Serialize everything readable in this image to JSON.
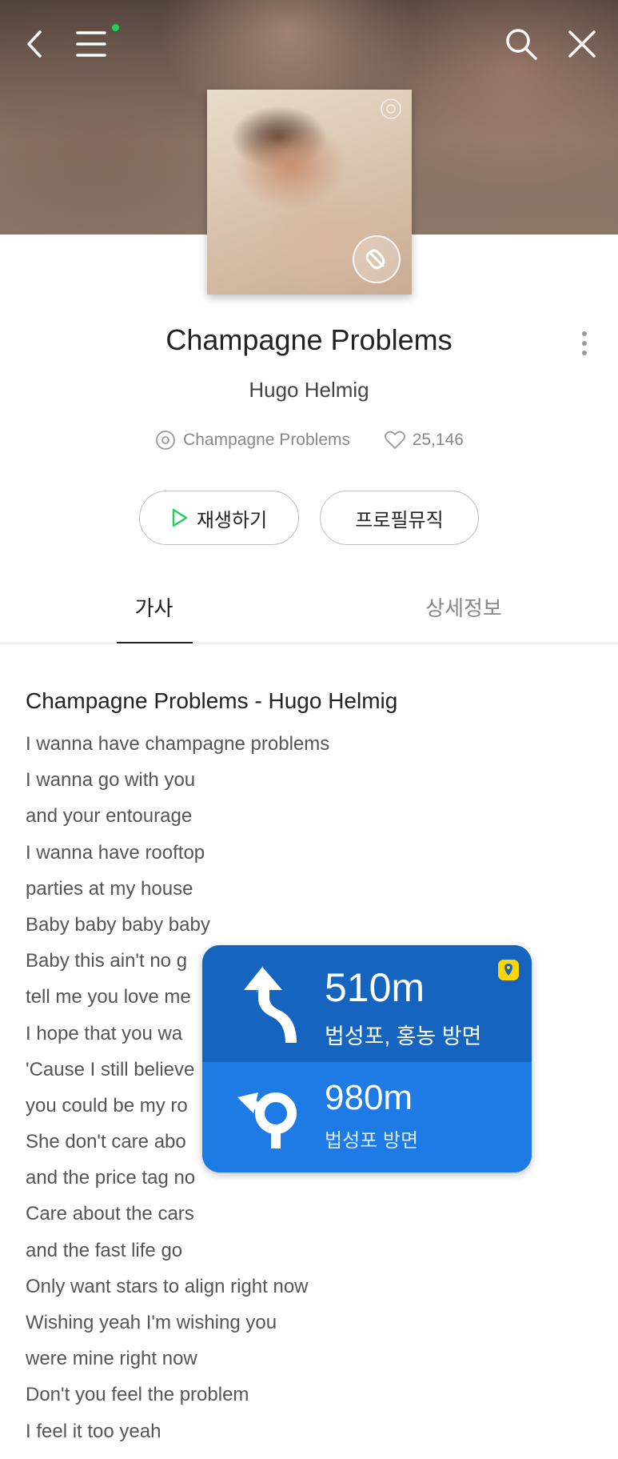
{
  "header": {
    "back_icon": "back-chevron-icon",
    "menu_icon": "hamburger-menu-icon",
    "search_icon": "search-icon",
    "close_icon": "close-icon",
    "menu_badge_color": "#1ecf5a"
  },
  "song": {
    "title": "Champagne Problems",
    "artist": "Hugo Helmig",
    "album": "Champagne Problems",
    "likes": "25,146"
  },
  "buttons": {
    "play": "재생하기",
    "profile_music": "프로필뮤직",
    "play_icon_color": "#1ecf5a"
  },
  "tabs": {
    "lyrics": "가사",
    "details": "상세정보"
  },
  "lyrics": {
    "heading": "Champagne Problems - Hugo Helmig",
    "lines": [
      "I wanna have champagne problems",
      "I wanna go with you",
      "and your entourage",
      "I wanna have rooftop",
      "parties at my house",
      "Baby baby baby baby",
      "Baby this ain't no g",
      "tell me you love me",
      "I hope that you wa",
      "'Cause I still believe",
      "you could be my ro",
      "She don't care abo",
      "and the price tag no",
      "Care about the cars",
      "and the fast life go",
      "Only want stars to align right now",
      "Wishing yeah I'm wishing you",
      "were mine right now",
      "Don't you feel the problem",
      "I feel it too yeah"
    ]
  },
  "navigation": {
    "primary": {
      "distance": "510m",
      "direction": "법성포, 홍농 방면",
      "icon": "turn-left-then-up-arrow-icon"
    },
    "secondary": {
      "distance": "980m",
      "direction": "법성포 방면",
      "icon": "u-turn-left-arrow-icon"
    },
    "pin_icon": "map-pin-icon",
    "colors": {
      "primary_bg": "#1565c0",
      "secondary_bg": "#1e7be6",
      "pin": "#ffd600"
    }
  }
}
